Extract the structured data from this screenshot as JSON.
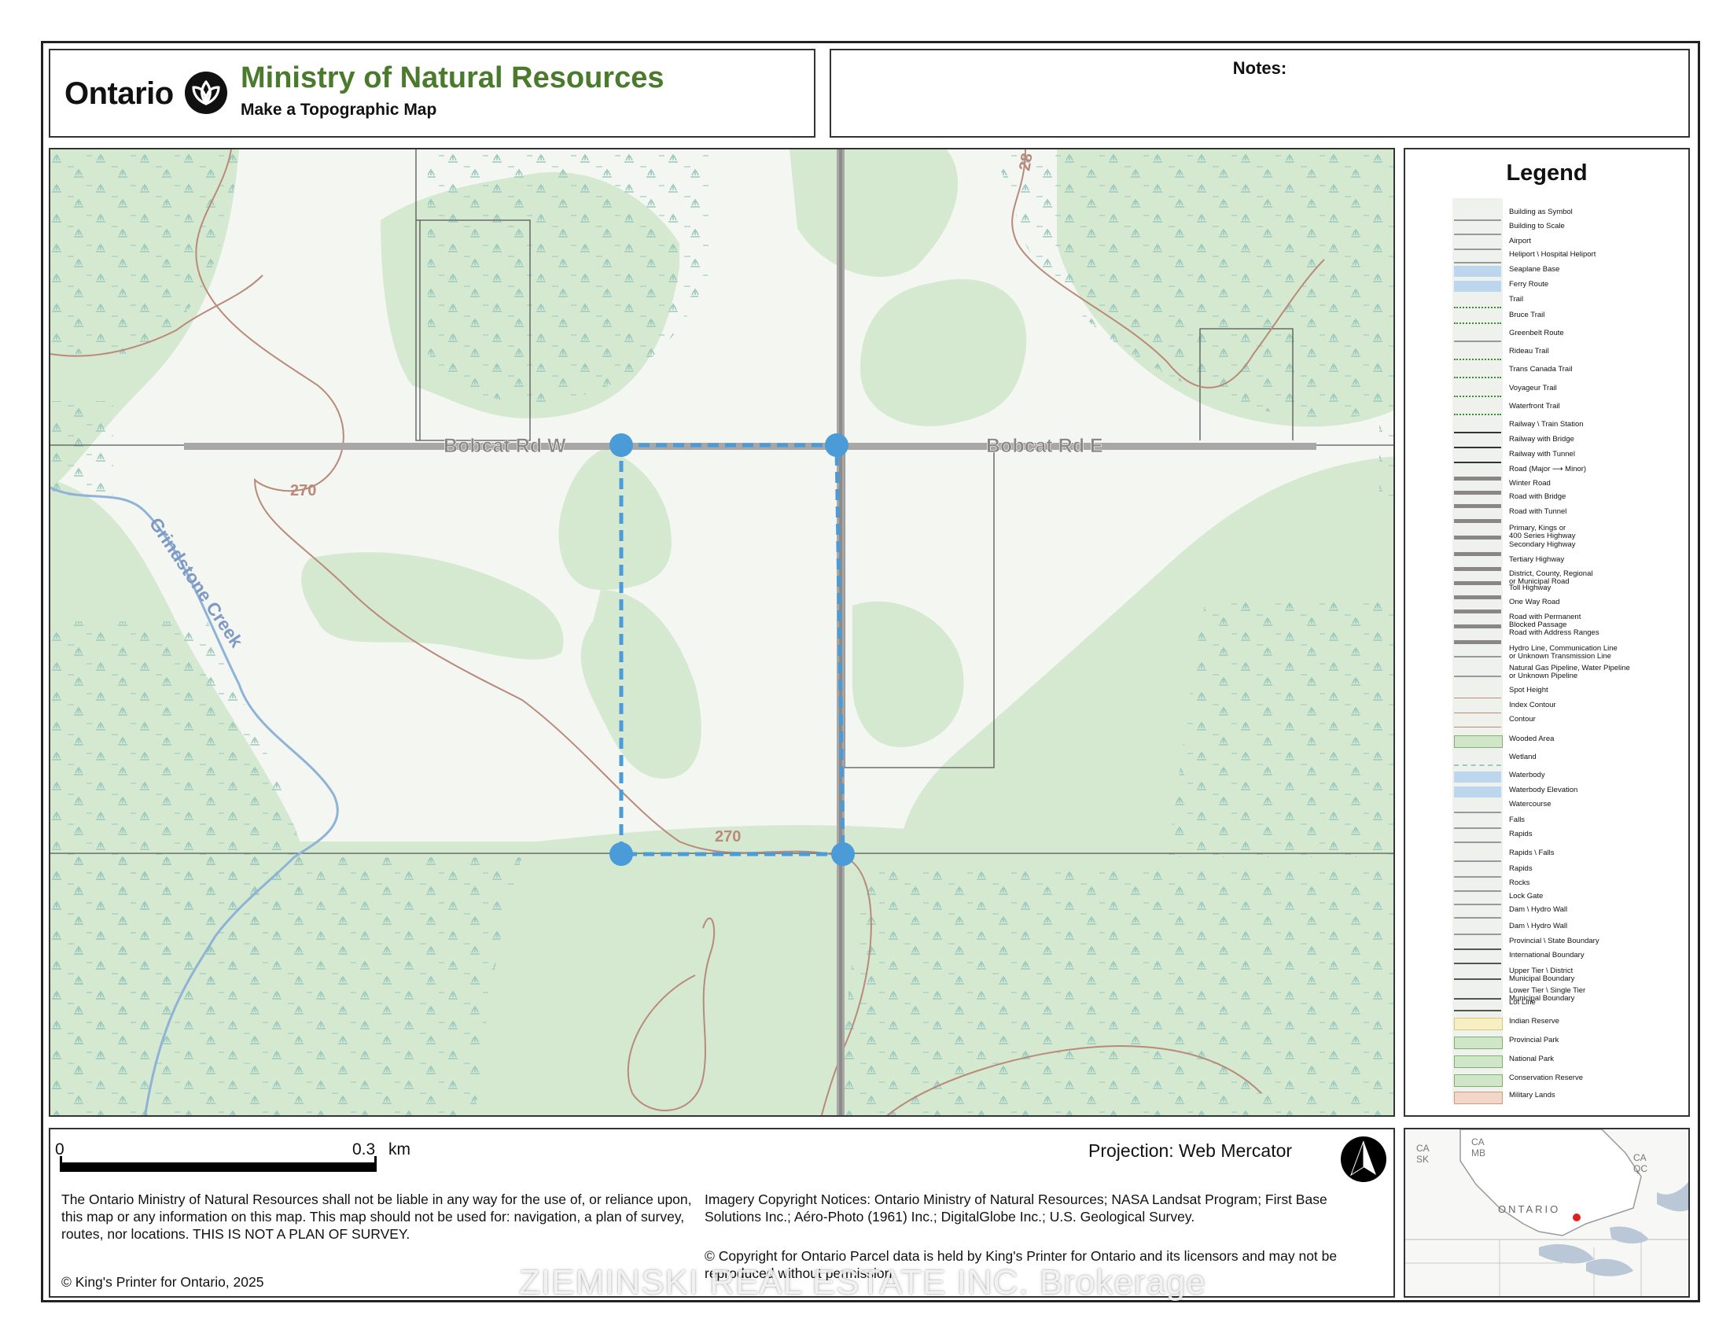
{
  "header": {
    "wordmark": "Ontario",
    "ministry": "Ministry of Natural Resources",
    "subtitle": "Make a Topographic Map"
  },
  "notes": {
    "label": "Notes:"
  },
  "map": {
    "road_labels": [
      "Bobcat Rd W",
      "Bobcat Rd E"
    ],
    "creek_label": "Grindstone Creek",
    "contour_labels": [
      "270",
      "270",
      "28"
    ],
    "parcel_outline_color": "#4a9bd8",
    "wooded_color": "#d5e8d0",
    "open_color": "#f4f6f2"
  },
  "legend": {
    "title": "Legend",
    "items": [
      "Building as Symbol",
      "Building to Scale",
      "Airport",
      "Heliport \\ Hospital Heliport",
      "Seaplane Base",
      "Ferry Route",
      "Trail",
      "Bruce Trail",
      "Greenbelt Route",
      "Rideau Trail",
      "Trans Canada Trail",
      "Voyageur Trail",
      "Waterfront Trail",
      "Railway \\ Train Station",
      "Railway with Bridge",
      "Railway with Tunnel",
      "Road (Major ⟶ Minor)",
      "Winter Road",
      "Road with Bridge",
      "Road with Tunnel",
      "Primary, Kings or\n400 Series Highway",
      "Secondary Highway",
      "Tertiary Highway",
      "District, County, Regional\nor Municipal Road",
      "Toll Highway",
      "One Way Road",
      "Road with Permanent\nBlocked Passage",
      "Road with Address Ranges",
      "Hydro Line, Communication Line\nor Unknown Transmission Line",
      "Natural Gas Pipeline, Water Pipeline\nor Unknown Pipeline",
      "Spot Height",
      "Index Contour",
      "Contour",
      "Wooded Area",
      "Wetland",
      "Waterbody",
      "Waterbody Elevation",
      "Watercourse",
      "Falls",
      "Rapids",
      "Rapids \\ Falls",
      "Rapids",
      "Rocks",
      "Lock Gate",
      "Dam \\ Hydro Wall",
      "Dam \\ Hydro Wall",
      "Provincial \\ State Boundary",
      "International Boundary",
      "Upper Tier \\ District\nMunicipal Boundary",
      "Lower Tier \\ Single Tier\nMunicipal Boundary",
      "Lot Line",
      "Indian Reserve",
      "Provincial Park",
      "National Park",
      "Conservation Reserve",
      "Military Lands"
    ]
  },
  "footer": {
    "scale_start": "0",
    "scale_end": "0.3",
    "scale_unit": "km",
    "projection": "Projection: Web Mercator",
    "disclaimer": "The Ontario Ministry of Natural Resources shall not be liable in any way for the use of, or reliance upon, this map or any information on this map.  This map should not be used for: navigation, a plan of survey, routes, nor locations. THIS IS NOT A PLAN OF SURVEY.",
    "copyright": "© King's Printer for Ontario,  2025",
    "imagery": "Imagery Copyright Notices: Ontario Ministry of Natural Resources; NASA Landsat Program; First Base Solutions Inc.; Aéro-Photo (1961) Inc.; DigitalGlobe Inc.; U.S. Geological Survey.",
    "parcel_notice": "© Copyright for Ontario Parcel data is held by King's Printer for Ontario and its licensors and may not be reproduced without permission."
  },
  "inset": {
    "labels": [
      "CA\nSK",
      "CA\nMB",
      "CA\nQC",
      "ONTARIO"
    ],
    "marker_color": "#e02020"
  },
  "watermark": "ZIEMINSKI REAL ESTATE INC. Brokerage"
}
